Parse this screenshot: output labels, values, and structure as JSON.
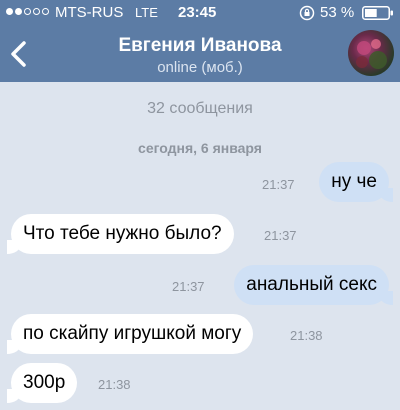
{
  "status_bar": {
    "carrier": "MTS-RUS",
    "network": "LTE",
    "time": "23:45",
    "battery": "53 %",
    "signal_strength": 2,
    "signal_max": 5,
    "battery_level": 0.53
  },
  "header": {
    "name": "Евгения Иванова",
    "status": "online (моб.)"
  },
  "chat": {
    "message_count": "32 сообщения",
    "date": "сегодня, 6 января",
    "messages": [
      {
        "direction": "out",
        "text": "ну че",
        "time": "21:37"
      },
      {
        "direction": "in",
        "text": "Что тебе нужно было?",
        "time": "21:37"
      },
      {
        "direction": "out",
        "text": "анальный секс",
        "time": "21:37"
      },
      {
        "direction": "in",
        "text": "по скайпу игрушкой могу",
        "time": "21:38"
      },
      {
        "direction": "in",
        "text": "300р",
        "time": "21:38"
      }
    ]
  },
  "colors": {
    "bar": "#5c7ca5",
    "background": "#dde4ee",
    "outgoing_bubble": "#cfe0f5",
    "incoming_bubble": "#ffffff"
  }
}
